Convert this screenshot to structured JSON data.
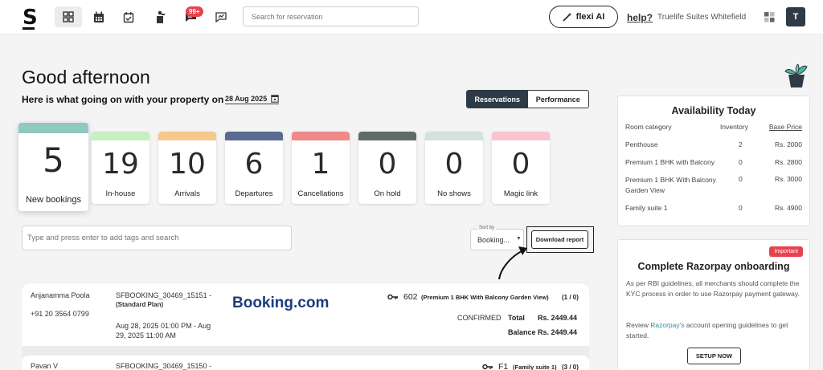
{
  "topbar": {
    "logo": "S",
    "notifications_badge": "99+",
    "search_placeholder": "Search for reservation",
    "flexi_label": "flexi AI",
    "help_label": "help?",
    "property_name": "Truelife Suites Whitefield",
    "avatar_initial": "T"
  },
  "greeting": {
    "title": "Good afternoon",
    "subtitle": "Here is what going on with your property on",
    "date": "28 Aug 2025"
  },
  "view_toggle": {
    "reservations": "Reservations",
    "performance": "Performance"
  },
  "stats": [
    {
      "value": "5",
      "label": "New bookings",
      "color": "#8fc9c1"
    },
    {
      "value": "19",
      "label": "In-house",
      "color": "#c8efc3"
    },
    {
      "value": "10",
      "label": "Arrivals",
      "color": "#f5c98c"
    },
    {
      "value": "6",
      "label": "Departures",
      "color": "#5b6a93"
    },
    {
      "value": "1",
      "label": "Cancellations",
      "color": "#ef8a8a"
    },
    {
      "value": "0",
      "label": "On hold",
      "color": "#5f6b66"
    },
    {
      "value": "0",
      "label": "No shows",
      "color": "#d3e3dc"
    },
    {
      "value": "0",
      "label": "Magic link",
      "color": "#f9c4cf"
    }
  ],
  "filters": {
    "tag_placeholder": "Type and press enter to add tags and search",
    "sort_label": "Sort by",
    "sort_value": "Booking...",
    "download_label": "Download report"
  },
  "reservations": [
    {
      "guest": "Anjanamma Poola",
      "phone": "+91 20 3564 0799",
      "booking_id": "SFBOOKING_30469_15151 -",
      "plan": "(Standard Plan)",
      "dates": "Aug 28, 2025 01:00 PM - Aug 29, 2025 11:00 AM",
      "source": "Booking.com",
      "room": "602",
      "room_type": "(Premium 1 BHK With Balcony Garden View)",
      "room_count": "(1 / 0)",
      "status": "CONFIRMED",
      "total_label": "Total",
      "total": "Rs. 2449.44",
      "balance_label": "Balance",
      "balance": "Rs. 2449.44"
    },
    {
      "guest": "Pavan V",
      "booking_id": "SFBOOKING_30469_15150 -",
      "room": "F1",
      "room_type": "(Family suite 1)",
      "room_count": "(3 / 0)"
    }
  ],
  "availability": {
    "title": "Availability Today",
    "headers": [
      "Room category",
      "Inventory",
      "Base Price"
    ],
    "rows": [
      {
        "category": "Penthouse",
        "inventory": "2",
        "price": "Rs. 2000"
      },
      {
        "category": "Premium 1 BHK with Balcony",
        "inventory": "0",
        "price": "Rs. 2800"
      },
      {
        "category": "Premium 1 BHK With Balcony Garden View",
        "inventory": "0",
        "price": "Rs. 3000"
      },
      {
        "category": "Family suite 1",
        "inventory": "0",
        "price": "Rs. 4900"
      }
    ]
  },
  "razorpay": {
    "badge": "Important",
    "title": "Complete Razorpay onboarding",
    "body": "As per RBI guidelines, all merchants should complete the KYC process in order to use Razorpay payment gateway.",
    "review_prefix": "Review ",
    "review_link": "Razorpay's",
    "review_suffix": " account opening guidelines to get started.",
    "button": "SETUP NOW"
  }
}
